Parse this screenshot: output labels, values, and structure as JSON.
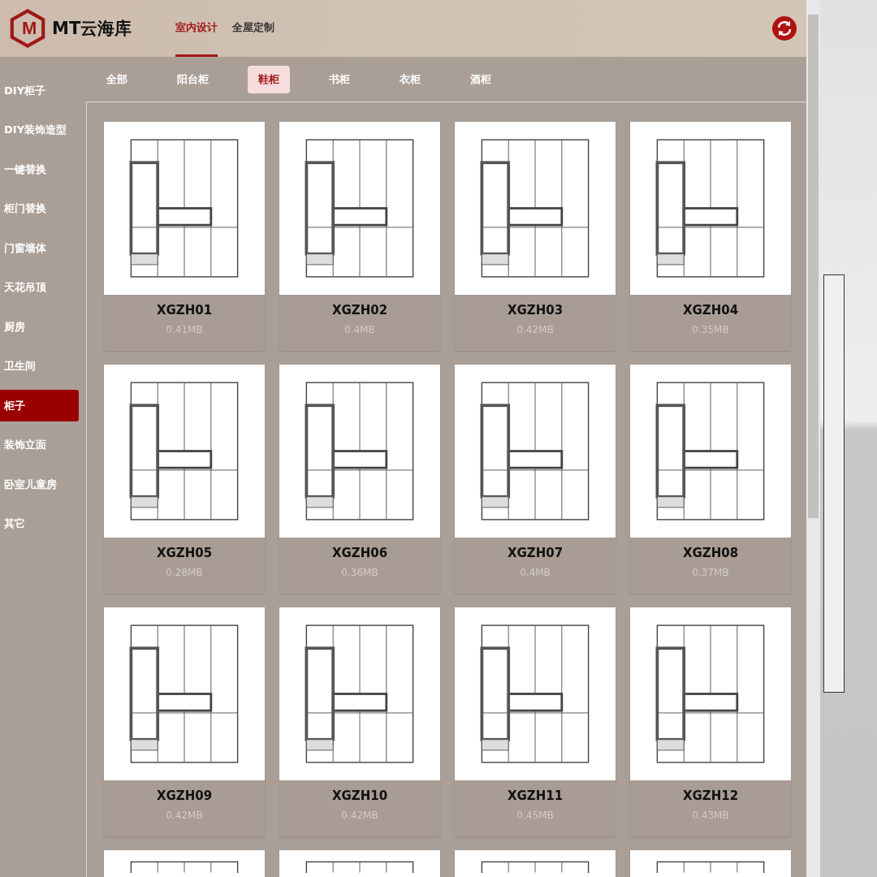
{
  "header": {
    "logo_letter": "M",
    "brand": "MT云海库",
    "nav": [
      {
        "label": "室内设计",
        "selected": true
      },
      {
        "label": "全屋定制",
        "selected": false
      }
    ]
  },
  "sidebar": {
    "items": [
      {
        "label": "DIY柜子",
        "selected": false
      },
      {
        "label": "DIY装饰造型",
        "selected": false
      },
      {
        "label": "一键替换",
        "selected": false
      },
      {
        "label": "柜门替换",
        "selected": false
      },
      {
        "label": "门窗墙体",
        "selected": false
      },
      {
        "label": "天花吊顶",
        "selected": false
      },
      {
        "label": "厨房",
        "selected": false
      },
      {
        "label": "卫生间",
        "selected": false
      },
      {
        "label": "柜子",
        "selected": true
      },
      {
        "label": "装饰立面",
        "selected": false
      },
      {
        "label": "卧室儿童房",
        "selected": false
      },
      {
        "label": "其它",
        "selected": false
      }
    ]
  },
  "tabs": [
    {
      "label": "全部",
      "selected": false
    },
    {
      "label": "阳台柜",
      "selected": false
    },
    {
      "label": "鞋柜",
      "selected": true
    },
    {
      "label": "书柜",
      "selected": false
    },
    {
      "label": "衣柜",
      "selected": false
    },
    {
      "label": "酒柜",
      "selected": false
    }
  ],
  "models": [
    {
      "name": "XGZH01",
      "size": "0.41MB"
    },
    {
      "name": "XGZH02",
      "size": "0.4MB"
    },
    {
      "name": "XGZH03",
      "size": "0.42MB"
    },
    {
      "name": "XGZH04",
      "size": "0.35MB"
    },
    {
      "name": "XGZH05",
      "size": "0.28MB"
    },
    {
      "name": "XGZH06",
      "size": "0.36MB"
    },
    {
      "name": "XGZH07",
      "size": "0.4MB"
    },
    {
      "name": "XGZH08",
      "size": "0.37MB"
    },
    {
      "name": "XGZH09",
      "size": "0.42MB"
    },
    {
      "name": "XGZH10",
      "size": "0.42MB"
    },
    {
      "name": "XGZH11",
      "size": "0.45MB"
    },
    {
      "name": "XGZH12",
      "size": "0.43MB"
    }
  ]
}
